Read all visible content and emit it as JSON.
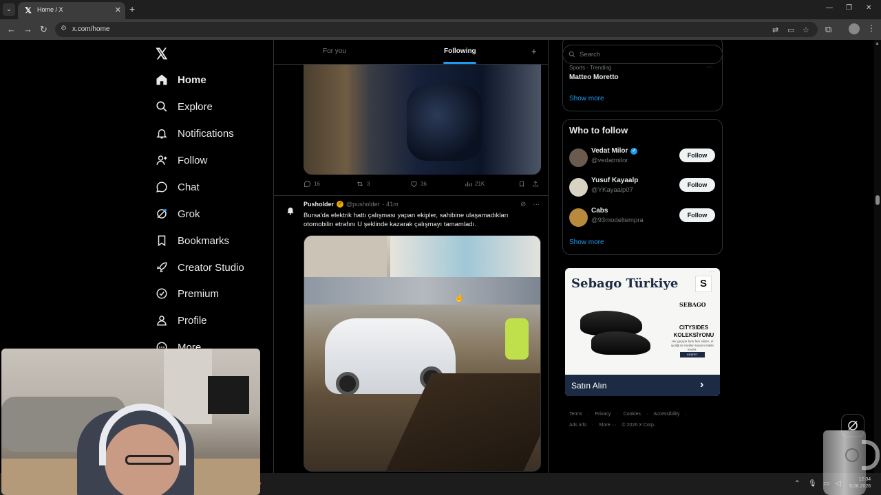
{
  "browser": {
    "tab_title": "Home / X",
    "tab_favicon": "𝕏",
    "url": "x.com/home",
    "new_tab": "+",
    "close_tab": "✕"
  },
  "nav": {
    "logo": "𝕏",
    "items": [
      {
        "label": "Home",
        "icon": "home-icon",
        "active": true
      },
      {
        "label": "Explore",
        "icon": "search-icon"
      },
      {
        "label": "Notifications",
        "icon": "bell-icon"
      },
      {
        "label": "Follow",
        "icon": "person-plus-icon"
      },
      {
        "label": "Chat",
        "icon": "chat-bubble-icon"
      },
      {
        "label": "Grok",
        "icon": "grok-icon"
      },
      {
        "label": "Bookmarks",
        "icon": "bookmark-icon"
      },
      {
        "label": "Creator Studio",
        "icon": "rocket-icon"
      },
      {
        "label": "Premium",
        "icon": "verified-badge-icon"
      },
      {
        "label": "Profile",
        "icon": "person-icon"
      },
      {
        "label": "More",
        "icon": "more-circle-icon"
      }
    ]
  },
  "timeline": {
    "tab_for_you": "For you",
    "tab_following": "Following",
    "add_tab": "+",
    "prev_post_actions": {
      "replies": "16",
      "reposts": "3",
      "likes": "36",
      "views": "21K"
    },
    "post": {
      "name": "Pusholder",
      "handle": "@pusholder",
      "time": "· 41m",
      "text": "Bursa'da elektrik hattı çalışması yapan ekipler, sahibine ulaşamadıkları otomobilin etrafını U şeklinde kazarak çalışmayı tamamladı."
    }
  },
  "sidebar": {
    "search_placeholder": "Search",
    "trend_header_cut": "Sports · Trending",
    "trend": {
      "meta": "Sports · Trending",
      "name": "Matteo Moretto"
    },
    "show_more": "Show more",
    "who_to_follow_title": "Who to follow",
    "users": [
      {
        "name": "Vedat Milor",
        "handle": "@vedatmilor",
        "verified": true,
        "avatar_color": "#6b5a4e"
      },
      {
        "name": "Yusuf Kayaalp",
        "handle": "@YKayaalp07",
        "verified": false,
        "avatar_color": "#d8d2c2"
      },
      {
        "name": "Cabs",
        "handle": "@93modeltempra",
        "verified": false,
        "avatar_color": "#b88a3c"
      }
    ],
    "follow_label": "Follow",
    "ad": {
      "title": "Sebago Türkiye",
      "logo": "S",
      "brand": "SEBAGO",
      "headline": "CITYSIDES KOLEKSİYONU",
      "small_text": "Her geçişte farkı fark edilen, el işçiliği ile üretilen tasarım kalite keşfet.",
      "button": "KEŞFET",
      "cta": "Satın Alın"
    },
    "footer_links": [
      "Terms",
      "·",
      "Privacy",
      "·",
      "Cookies",
      "·",
      "Accessibility",
      "·"
    ],
    "footer_links2": [
      "Ads info",
      "·",
      "More ···",
      "© 2026 X Corp."
    ]
  },
  "taskbar": {
    "time": "12:04",
    "date": "5.06.2026"
  },
  "colors": {
    "accent": "#1d9bf0",
    "background": "#000000",
    "text": "#e7e9ea",
    "muted": "#71767b",
    "border": "#2f3336"
  }
}
